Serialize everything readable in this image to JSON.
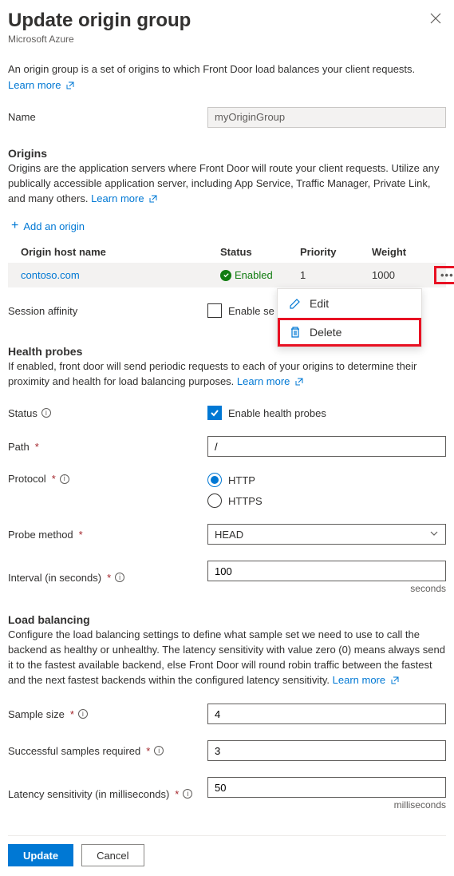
{
  "header": {
    "title": "Update origin group",
    "subtitle": "Microsoft Azure"
  },
  "intro": {
    "text": "An origin group is a set of origins to which Front Door load balances your client requests.",
    "learn_more": "Learn more"
  },
  "name_field": {
    "label": "Name",
    "value": "myOriginGroup"
  },
  "origins": {
    "heading": "Origins",
    "desc": "Origins are the application servers where Front Door will route your client requests. Utilize any publically accessible application server, including App Service, Traffic Manager, Private Link, and many others.",
    "learn_more": "Learn more",
    "add_label": "Add an origin",
    "columns": {
      "host": "Origin host name",
      "status": "Status",
      "priority": "Priority",
      "weight": "Weight"
    },
    "row": {
      "host": "contoso.com",
      "status": "Enabled",
      "priority": "1",
      "weight": "1000"
    },
    "context_menu": {
      "edit": "Edit",
      "delete": "Delete"
    }
  },
  "session_affinity": {
    "label": "Session affinity",
    "checkbox_label": "Enable se"
  },
  "health": {
    "heading": "Health probes",
    "desc": "If enabled, front door will send periodic requests to each of your origins to determine their proximity and health for load balancing purposes.",
    "learn_more": "Learn more",
    "status_label": "Status",
    "enable_label": "Enable health probes",
    "path_label": "Path",
    "path_value": "/",
    "protocol_label": "Protocol",
    "protocol_http": "HTTP",
    "protocol_https": "HTTPS",
    "probe_method_label": "Probe method",
    "probe_method_value": "HEAD",
    "interval_label": "Interval (in seconds)",
    "interval_value": "100",
    "interval_unit": "seconds"
  },
  "lb": {
    "heading": "Load balancing",
    "desc": "Configure the load balancing settings to define what sample set we need to use to call the backend as healthy or unhealthy. The latency sensitivity with value zero (0) means always send it to the fastest available backend, else Front Door will round robin traffic between the fastest and the next fastest backends within the configured latency sensitivity.",
    "learn_more": "Learn more",
    "sample_label": "Sample size",
    "sample_value": "4",
    "success_label": "Successful samples required",
    "success_value": "3",
    "latency_label": "Latency sensitivity (in milliseconds)",
    "latency_value": "50",
    "latency_unit": "milliseconds"
  },
  "footer": {
    "update": "Update",
    "cancel": "Cancel"
  }
}
